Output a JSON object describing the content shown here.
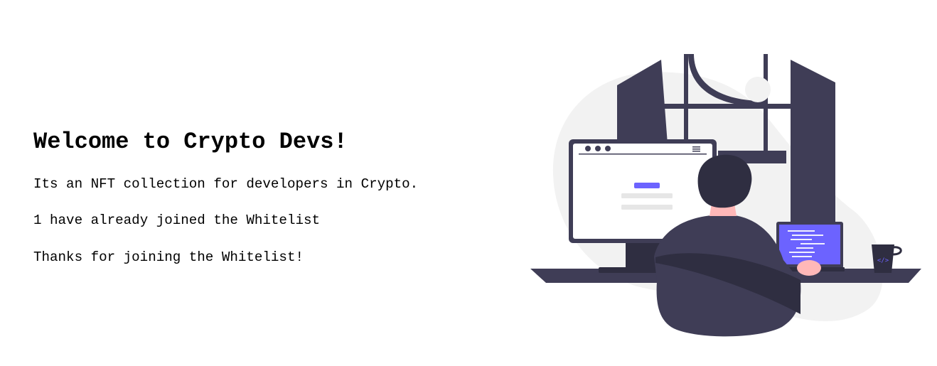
{
  "main": {
    "title": "Welcome to Crypto Devs!",
    "description": "Its an NFT collection for developers in Crypto.",
    "whitelist_count": "1",
    "whitelist_text": " have already joined the Whitelist",
    "status_message": "Thanks for joining the Whitelist!"
  },
  "illustration": {
    "name": "developer-at-desk-illustration",
    "laptop_code_icon": "code-brackets-icon",
    "accent": "#6c63ff",
    "dark": "#3f3d56",
    "darker": "#2f2e41",
    "light_gray": "#f2f2f2",
    "skin": "#ffb8b8"
  }
}
